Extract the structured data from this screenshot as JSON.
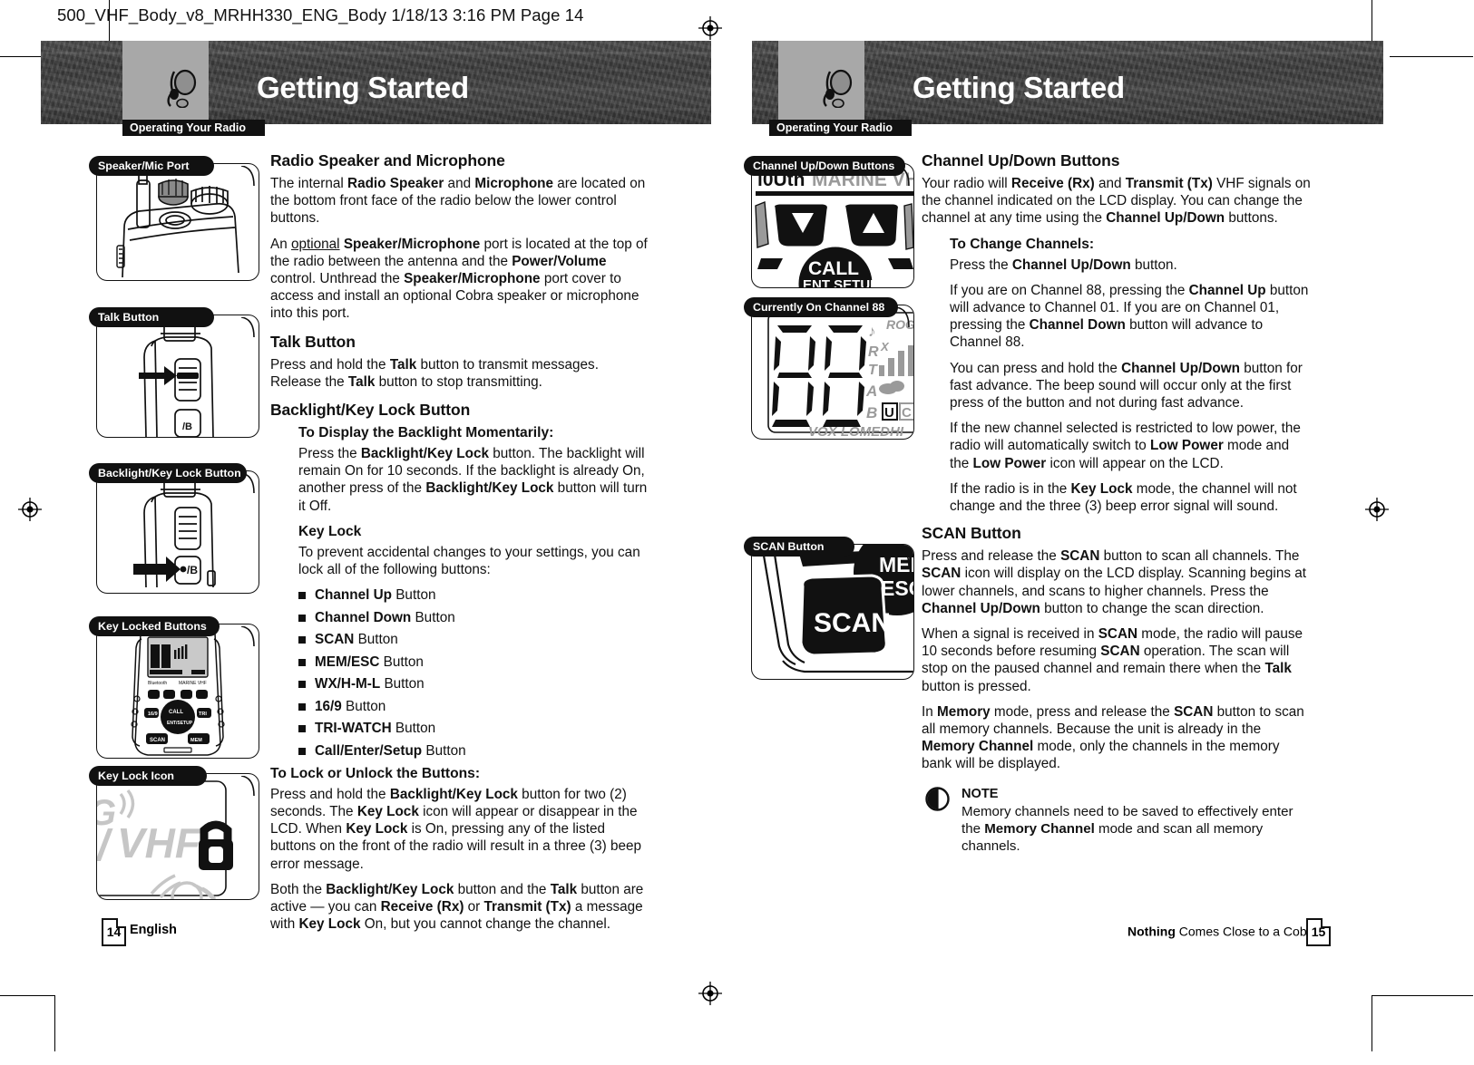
{
  "document": {
    "slug": "500_VHF_Body_v8_MRHH330_ENG_Body  1/18/13  3:16 PM  Page 14"
  },
  "left_page": {
    "header": {
      "tab": "Operating Your Radio",
      "title": "Getting Started"
    },
    "figures": [
      {
        "label": "Speaker/Mic Port",
        "art": "radio-top-speaker-mic-port"
      },
      {
        "label": "Talk Button",
        "art": "radio-side-talk-button"
      },
      {
        "label": "Backlight/Key Lock Button",
        "art": "radio-side-backlight-key-lock-button"
      },
      {
        "label": "Key Locked Buttons",
        "art": "radio-front-full-view"
      },
      {
        "label": "Key Lock Icon",
        "art": "lcd-key-lock-padlock"
      }
    ],
    "lcd_art_text": {
      "vhf": "VHF"
    },
    "sections": [
      {
        "heading": "Radio Speaker and Microphone",
        "paragraphs": [
          "The internal <b>Radio Speaker</b> and <b>Microphone</b> are located on the bottom front face of the radio below the lower control buttons.",
          "An <u>optional</u> <b>Speaker/Microphone</b> port is located at the top of the radio between the antenna and the <b>Power/Volume</b> control. Unthread the <b>Speaker/Microphone</b> port cover to access and install an optional Cobra speaker or microphone into this port."
        ]
      },
      {
        "heading": "Talk Button",
        "paragraphs": [
          "Press and hold the <b>Talk</b> button to transmit messages. Release the <b>Talk</b> button to stop transmitting."
        ]
      },
      {
        "heading": "Backlight/Key Lock Button",
        "subsections": [
          {
            "subheading": "To Display the Backlight Momentarily:",
            "paragraphs": [
              "Press the <b>Backlight/Key Lock</b> button. The backlight will remain On for 10 seconds. If the backlight is already On, another press of the <b>Backlight/Key Lock</b> button will turn it Off."
            ]
          },
          {
            "subheading": "Key Lock",
            "paragraphs": [
              "To prevent accidental changes to your settings, you can lock all of the following buttons:"
            ],
            "bullets": [
              "<b>Channel Up</b> Button",
              "<b>Channel Down</b> Button",
              "<b>SCAN</b> Button",
              "<b>MEM/ESC</b> Button",
              "<b>WX/H-M-L</b> Button",
              "<b>16/9</b> Button",
              "<b>TRI-WATCH</b> Button",
              "<b>Call/Enter/Setup</b> Button"
            ]
          },
          {
            "subheading": "To Lock or Unlock the Buttons:",
            "paragraphs": [
              "Press and hold the <b>Backlight/Key Lock</b> button for two (2) seconds. The <b>Key Lock</b> icon will appear or disappear in the LCD. When <b>Key Lock</b> is On, pressing any of the listed buttons on the front of the radio will result in a three (3) beep error message.",
              "Both the <b>Backlight/Key Lock</b> button and the <b>Talk</b> button are active — you can <b>Receive (Rx)</b> or <b>Transmit (Tx)</b> a message with <b>Key Lock</b> On, but you cannot change the channel."
            ]
          }
        ]
      }
    ],
    "footer": {
      "page_number": "14",
      "language": "English"
    }
  },
  "right_page": {
    "header": {
      "tab": "Operating Your Radio",
      "title": "Getting Started"
    },
    "figures": [
      {
        "label": "Channel Up/Down Buttons",
        "art": "radio-keypad-up-down-call"
      },
      {
        "label": "Currently On Channel 88",
        "art": "lcd-channel-88"
      },
      {
        "label": "SCAN Button",
        "art": "radio-scan-button"
      }
    ],
    "lcd_art_text": {
      "top_band_left": "l0Uth",
      "top_band_right": "MARINE VHF",
      "call_main": "CALL",
      "call_sub": "ENT SETUP",
      "channel": "88",
      "icons_rog": "ROG",
      "icons_rx": "R",
      "icons_x": "X",
      "icons_t": "T",
      "icons_a": "A",
      "icons_b": "B",
      "icons_u": "U",
      "icons_c": "C",
      "bottom_strip": "VOX LO MED HI",
      "mem_label": "MEM",
      "esc_label": "ESC",
      "scan_label": "SCAN"
    },
    "sections": [
      {
        "heading": "Channel Up/Down Buttons",
        "paragraphs": [
          "Your radio will <b>Receive (Rx)</b> and <b>Transmit (Tx)</b> VHF signals on the channel indicated on the LCD display. You can change the channel at any time using the <b>Channel Up/Down</b> buttons."
        ],
        "subsections": [
          {
            "subheading": "To Change Channels:",
            "paragraphs": [
              "Press the <b>Channel Up/Down</b> button.",
              "If you are on Channel 88, pressing the <b>Channel Up</b> button will advance to Channel 01. If you are on Channel 01, pressing the <b>Channel Down</b> button will advance to Channel 88.",
              "You can press and hold the <b>Channel Up/Down</b> button for fast advance. The beep sound will occur only at the first press of the button and not during fast advance.",
              "If the new channel selected is restricted to low power, the radio will automatically switch to <b>Low Power</b> mode and the <b>Low Power</b> icon will appear on the LCD.",
              "If the radio is in the <b>Key Lock</b> mode, the channel will not change and the three (3) beep error signal will sound."
            ]
          }
        ]
      },
      {
        "heading": "SCAN Button",
        "paragraphs": [
          "Press and release the <b>SCAN</b> button to scan all channels. The <b>SCAN</b> icon will display on the LCD display. Scanning begins at lower channels, and scans to higher channels. Press the <b>Channel Up/Down</b> button to change the scan direction.",
          "When a signal is received in <b>SCAN</b> mode, the radio will pause 10 seconds before resuming <b>SCAN</b> operation. The scan will stop on the paused channel and remain there when the <b>Talk</b> button is pressed.",
          "In <b>Memory</b> mode, press and release the <b>SCAN</b> button to scan all memory channels. Because the unit is already in the <b>Memory Channel</b> mode, only the channels in the memory bank will be displayed."
        ],
        "note": {
          "title": "NOTE",
          "body": "Memory channels need to be saved to effectively enter the <b>Memory Channel</b> mode and scan all memory channels."
        }
      }
    ],
    "footer": {
      "page_number": "15",
      "tagline_bold": "Nothing",
      "tagline_rest": " Comes Close to a Cobra",
      "tagline_mark": "®"
    }
  }
}
